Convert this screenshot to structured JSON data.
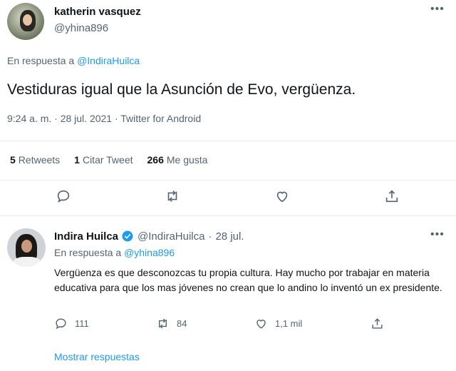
{
  "colors": {
    "accent": "#1d9bf0",
    "secondary_text": "#536471",
    "primary_text": "#0f1419",
    "divider": "#e6ecf0"
  },
  "main_tweet": {
    "author_name": "katherin vasquez",
    "author_handle": "@yhina896",
    "reply_prefix": "En respuesta a ",
    "reply_to": "@IndiraHuilca",
    "text": "Vestiduras igual que la Asunción de Evo, vergüenza.",
    "meta": "9:24 a. m. · 28 jul. 2021 · Twitter for Android",
    "stats": [
      {
        "count": "5",
        "label": "Retweets"
      },
      {
        "count": "1",
        "label": "Citar Tweet"
      },
      {
        "count": "266",
        "label": "Me gusta"
      }
    ],
    "action_icons": [
      "reply-icon",
      "retweet-icon",
      "like-icon",
      "share-icon"
    ]
  },
  "reply_tweet": {
    "author_name": "Indira Huilca",
    "verified": true,
    "author_handle": "@IndiraHuilca",
    "separator": "·",
    "date": "28 jul.",
    "reply_prefix": "En respuesta a ",
    "reply_to": "@yhina896",
    "text": "Vergüenza es que desconozcas tu propia cultura. Hay mucho por trabajar en materia educativa para que los mas jóvenes no crean que lo andino lo inventó un ex presidente.",
    "reply_count": "111",
    "retweet_count": "84",
    "like_count": "1,1 mil",
    "show_replies": "Mostrar respuestas"
  }
}
